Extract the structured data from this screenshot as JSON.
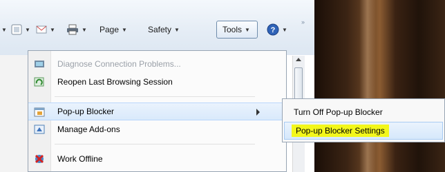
{
  "toolbar": {
    "page_label": "Page",
    "safety_label": "Safety",
    "tools_label": "Tools",
    "overflow_glyph": "»"
  },
  "menu": {
    "items": [
      {
        "label": "Diagnose Connection Problems...",
        "icon": "diagnose-icon",
        "enabled": false
      },
      {
        "label": "Reopen Last Browsing Session",
        "icon": "reopen-session-icon",
        "enabled": true
      },
      {
        "label": "Pop-up Blocker",
        "icon": "popup-blocker-icon",
        "enabled": true,
        "submenu": true
      },
      {
        "label": "Manage Add-ons",
        "icon": "addons-icon",
        "enabled": true
      },
      {
        "label": "Work Offline",
        "icon": "work-offline-icon",
        "enabled": true
      }
    ]
  },
  "submenu": {
    "items": [
      {
        "label": "Turn Off Pop-up Blocker"
      },
      {
        "label": "Pop-up Blocker Settings",
        "highlighted": true
      }
    ]
  },
  "colors": {
    "highlight": "#f3f71b",
    "hover": "#d9e9fb"
  }
}
